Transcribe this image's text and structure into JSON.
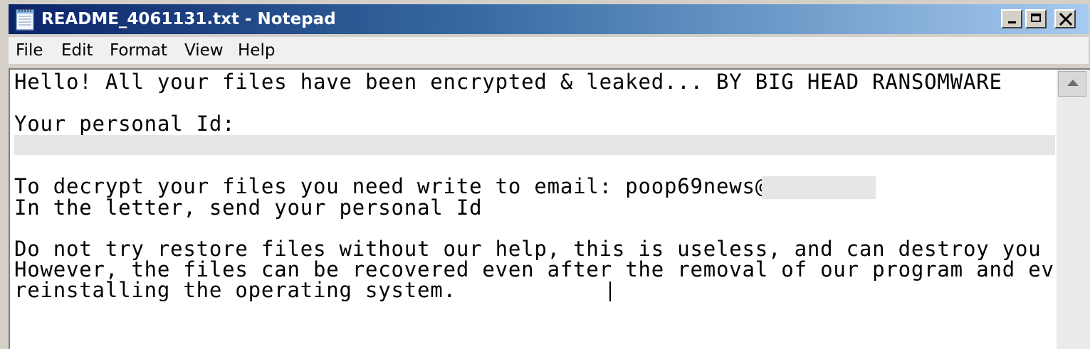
{
  "window": {
    "title": "README_4061131.txt - Notepad",
    "icon": "notepad-icon",
    "controls": {
      "minimize": "minimize-icon",
      "maximize": "maximize-icon",
      "close": "close-icon"
    }
  },
  "menu": {
    "items": [
      "File",
      "Edit",
      "Format",
      "View",
      "Help"
    ]
  },
  "document": {
    "lines": [
      "Hello! All your files have been encrypted & leaked... BY BIG HEAD RANSOMWARE",
      "",
      "Your personal Id:",
      "",
      "",
      "To decrypt your files you need write to email: poop69news@",
      "In the letter, send your personal Id",
      "",
      "Do not try restore files without our help, this is useless, and can destroy you d",
      "However, the files can be recovered even after the removal of our program and eve",
      "reinstalling the operating system."
    ]
  },
  "colors": {
    "title_gradient_start": "#0a246a",
    "title_gradient_end": "#a6caf0",
    "redaction": "#e6e6e6"
  }
}
